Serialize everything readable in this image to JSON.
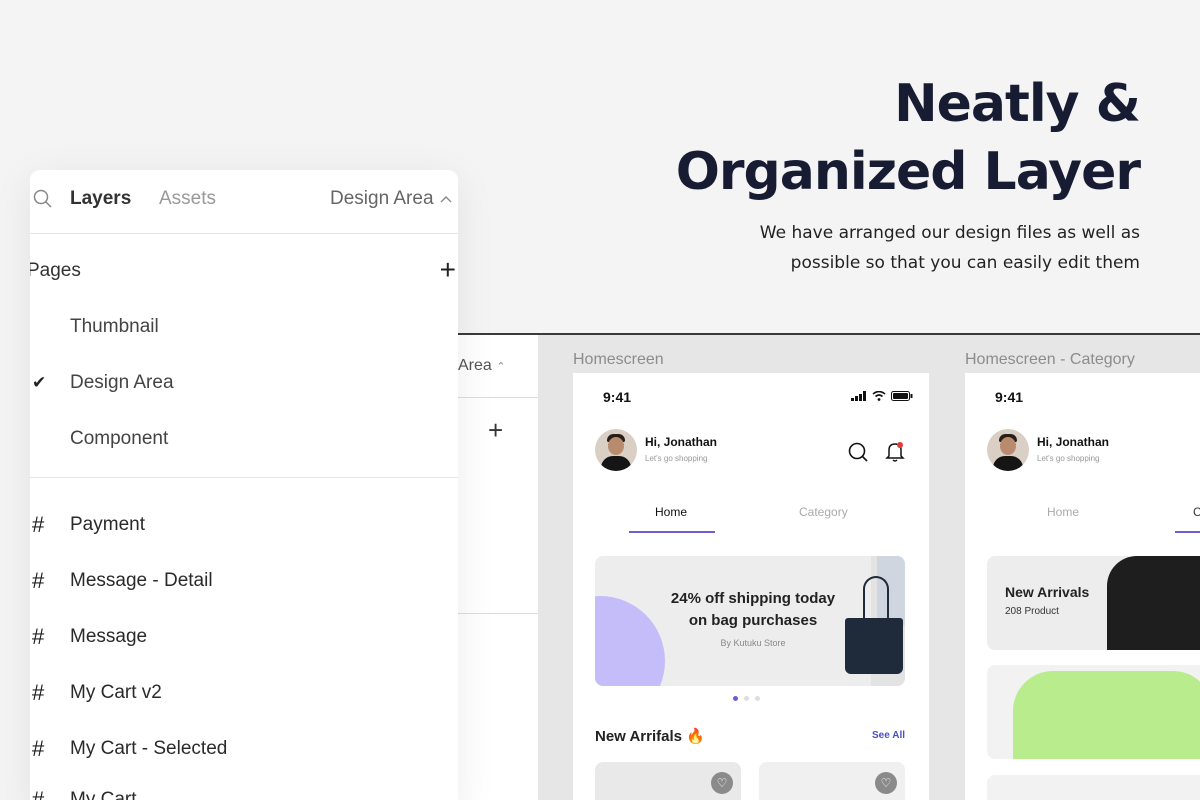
{
  "headline": {
    "title_line1": "Neatly &",
    "title_line2": "Organized Layer",
    "subtitle_line1": "We have arranged our design files as well as",
    "subtitle_line2": "possible so that you can easily edit them"
  },
  "back_panel": {
    "page_select": "Area"
  },
  "frames": [
    {
      "label": "Homescreen",
      "time": "9:41",
      "greeting": "Hi, Jonathan",
      "greeting_sub": "Let's go shopping",
      "tabs": [
        "Home",
        "Category"
      ],
      "banner_title": "24% off shipping today on bag purchases",
      "banner_sub": "By Kutuku Store",
      "section_title": "New Arrifals 🔥",
      "see_all": "See All"
    },
    {
      "label": "Homescreen - Category",
      "time": "9:41",
      "greeting": "Hi, Jonathan",
      "greeting_sub": "Let's go shopping",
      "tabs": [
        "Home",
        "C"
      ],
      "category_title": "New Arrivals",
      "category_count": "208 Product"
    }
  ],
  "layers_panel": {
    "tabs": [
      "Layers",
      "Assets"
    ],
    "page_select": "Design Area",
    "pages_heading": "Pages",
    "pages": [
      {
        "name": "Thumbnail",
        "selected": false
      },
      {
        "name": "Design Area",
        "selected": true
      },
      {
        "name": "Component",
        "selected": false
      }
    ],
    "layers": [
      "Payment",
      "Message - Detail",
      "Message",
      "My Cart v2",
      "My Cart - Selected",
      "My Cart"
    ]
  },
  "colors": {
    "accent": "#6b5fd0",
    "headline": "#181c33",
    "banner_blob": "#c5bdfa"
  }
}
